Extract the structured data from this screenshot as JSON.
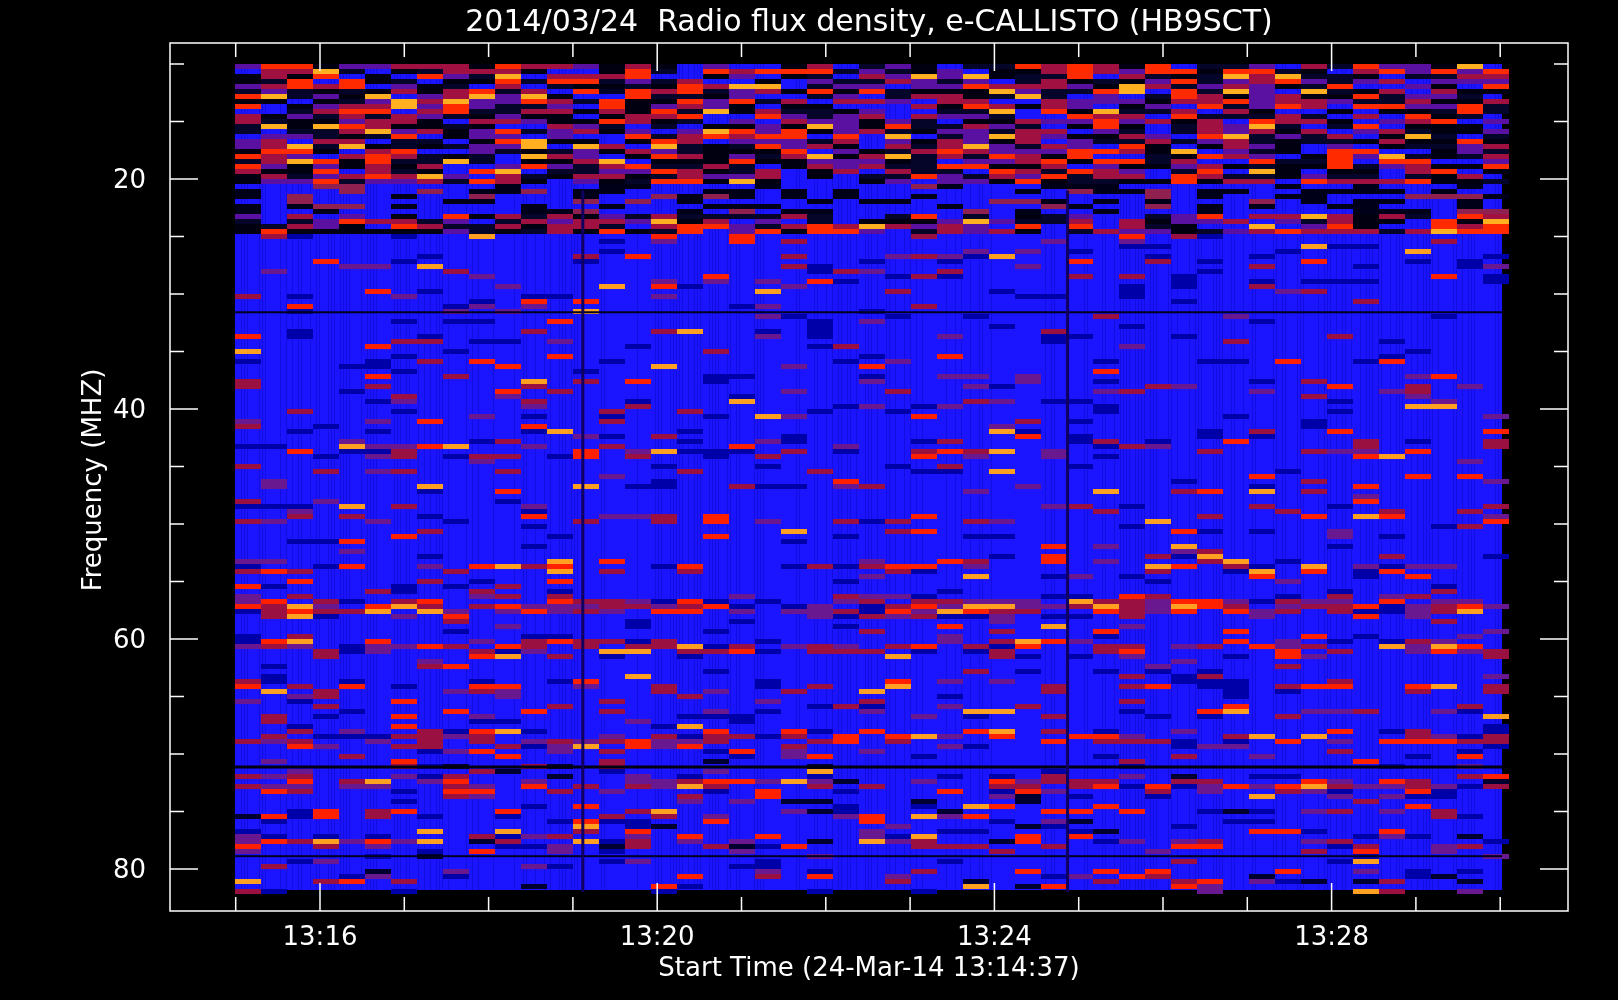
{
  "title": "2014/03/24  Radio flux density, e-CALLISTO (HB9SCT)",
  "y_axis": {
    "label": "Frequency (MHZ)",
    "ticks": [
      "20",
      "40",
      "60",
      "80"
    ]
  },
  "x_axis": {
    "label": "Start Time (24-Mar-14 13:14:37)",
    "ticks": [
      "13:16",
      "13:20",
      "13:24",
      "13:28"
    ]
  },
  "plot": {
    "kind": "spectrogram"
  }
}
